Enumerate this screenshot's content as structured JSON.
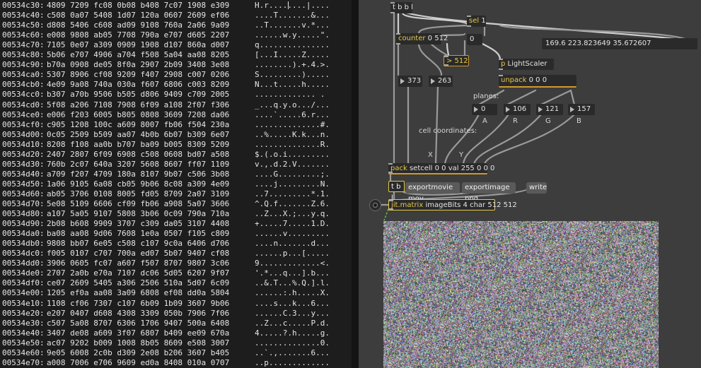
{
  "hexdump": {
    "rows": [
      {
        "addr": "00534c30:",
        "bytes": "4809 7209 fc08 0b08 b408 7c07 1908 e309",
        "ascii": "H.r........|...."
      },
      {
        "addr": "00534c40:",
        "bytes": "c508 0a07 5408 1d07 120a 0607 2609 ef06",
        "ascii": "....T.......&..."
      },
      {
        "addr": "00534c50:",
        "bytes": "d808 5406 c608 ad09 9108 760a 2a06 9a09",
        "ascii": "..T.......v.*..."
      },
      {
        "addr": "00534c60:",
        "bytes": "e008 9808 ab05 7708 790a e707 d605 2207",
        "ascii": "......w.y.....\"."
      },
      {
        "addr": "00534c70:",
        "bytes": "7105 0e07 a309 0909 1908 d107 860a d007",
        "ascii": "q..............."
      },
      {
        "addr": "00534c80:",
        "bytes": "5b06 e707 4906 a704 f508 5a04 aa08 8205",
        "ascii": "[...I.....Z....."
      },
      {
        "addr": "00534c90:",
        "bytes": "b70a 0908 de05 8f0a 2907 2b09 3408 3e08",
        "ascii": "........).+.4.>."
      },
      {
        "addr": "00534ca0:",
        "bytes": "5307 8906 cf08 9209 f407 2908 c007 0206",
        "ascii": "S.........)....."
      },
      {
        "addr": "00534cb0:",
        "bytes": "4e09 9a08 740a 030a f607 6806 c003 8209",
        "ascii": "N...t.....h....."
      },
      {
        "addr": "00534cc0:",
        "bytes": "b307 a70b 9506 b505 d806 9409 c709 2005",
        "ascii": "............. ."
      },
      {
        "addr": "00534cd0:",
        "bytes": "5f08 a206 7108 7908 6f09 a108 2f07 f306",
        "ascii": "_...q.y.o.../..."
      },
      {
        "addr": "00534ce0:",
        "bytes": "e006 f203 6005 b805 0808 3609 7208 da06",
        "ascii": "....`.....6.r..."
      },
      {
        "addr": "00534cf0:",
        "bytes": "c905 1208 100c a609 8007 fb06 f504 230a",
        "ascii": "..............#."
      },
      {
        "addr": "00534d00:",
        "bytes": "0c05 2509 b509 aa07 4b0b 6b07 b309 6e07",
        "ascii": "..%.....K.k...n."
      },
      {
        "addr": "00534d10:",
        "bytes": "8208 f108 aa0b b707 ba09 b005 8309 5209",
        "ascii": "..............R."
      },
      {
        "addr": "00534d20:",
        "bytes": "2407 2807 6f09 6908 c508 0608 bd07 a508",
        "ascii": "$.(.o.i........."
      },
      {
        "addr": "00534d30:",
        "bytes": "760b 2c07 640a 3207 5608 8607 ff07 1109",
        "ascii": "v.,.d.2.V......."
      },
      {
        "addr": "00534d40:",
        "bytes": "a709 f207 4709 180a 8107 9b07 c506 3b08",
        "ascii": "....G.........;."
      },
      {
        "addr": "00534d50:",
        "bytes": "1a06 9105 6a08 cb05 9b06 8c08 a309 4e09",
        "ascii": "....j.........N."
      },
      {
        "addr": "00534d60:",
        "bytes": "ab05 3706 0108 8005 fd05 8709 2a07 3109",
        "ascii": "..7.........*.1."
      },
      {
        "addr": "00534d70:",
        "bytes": "5e08 5109 6606 cf09 fb06 a908 5a07 3606",
        "ascii": "^.Q.f.......Z.6."
      },
      {
        "addr": "00534d80:",
        "bytes": "a107 5a05 9107 5808 3b06 0c09 790a 710a",
        "ascii": "..Z...X.;...y.q."
      },
      {
        "addr": "00534d90:",
        "bytes": "2b08 b608 9909 3707 c309 da05 3107 4408",
        "ascii": "+.....7.....1.D."
      },
      {
        "addr": "00534da0:",
        "bytes": "ba08 aa08 9d06 7608 1e0a 0507 f105 c809",
        "ascii": "......v........."
      },
      {
        "addr": "00534db0:",
        "bytes": "9808 bb07 6e05 c508 c107 9c0a 6406 d706",
        "ascii": "....n.......d..."
      },
      {
        "addr": "00534dc0:",
        "bytes": "f005 0107 c707 700a ed07 5b07 9407 cf08",
        "ascii": "......p...[....."
      },
      {
        "addr": "00534dd0:",
        "bytes": "3906 0605 fc07 a607 f507 8707 9807 3c06",
        "ascii": "9.............<."
      },
      {
        "addr": "00534de0:",
        "bytes": "2707 2a0b e70a 7107 dc06 5d05 6207 9f07",
        "ascii": "'.*...q...].b..."
      },
      {
        "addr": "00534df0:",
        "bytes": "ce07 2609 5405 a306 2506 510a 5d07 6c09",
        "ascii": "..&.T...%.Q.].l."
      },
      {
        "addr": "00534e00:",
        "bytes": "1205 ef0a aa08 3a09 6808 ef08 dd0a 5804",
        "ascii": "......:.h.....X."
      },
      {
        "addr": "00534e10:",
        "bytes": "1108 cf06 7307 c107 6b09 1b09 3607 9b06",
        "ascii": "....s...k...6..."
      },
      {
        "addr": "00534e20:",
        "bytes": "e207 0407 d608 4308 3309 050b 7906 7f06",
        "ascii": "......C.3...y..."
      },
      {
        "addr": "00534e30:",
        "bytes": "c507 5a08 8707 6306 1706 9407 500a 6408",
        "ascii": "..Z...c.....P.d."
      },
      {
        "addr": "00534e40:",
        "bytes": "3407 de08 a609 3f07 6807 b409 ee09 670a",
        "ascii": "4.....?.h.....g."
      },
      {
        "addr": "00534e50:",
        "bytes": "ac07 9202 b009 1008 8b05 8609 e508 3007",
        "ascii": "..............0."
      },
      {
        "addr": "00534e60:",
        "bytes": "9e05 6008 2c0b d309 2e08 b206 3607 b405",
        "ascii": "..`.,.......6..."
      },
      {
        "addr": "00534e70:",
        "bytes": "a008 7006 e706 9609 ed0a 8408 010a 0707",
        "ascii": "..p............."
      }
    ]
  },
  "patcher": {
    "tbbl_top": "t b b l",
    "counter": "counter",
    "counter_args": "0 512",
    "sel": "sel",
    "sel_args": "1",
    "num_zero": "0",
    "gt": "> 512",
    "list_display": "169.6 223.823649 35.672607",
    "p_obj": "p",
    "p_args": "LightScaler",
    "unpack": "unpack",
    "unpack_args": "0 0 0",
    "num_373": "373",
    "num_263": "263",
    "planes_label": "planes:",
    "num_0": "0",
    "num_106": "106",
    "num_121": "121",
    "num_157": "157",
    "label_a": "A",
    "label_r": "R",
    "label_g": "G",
    "label_b": "B",
    "cell_label": "cell coordinates:",
    "label_x": "X",
    "label_y": "Y",
    "pack": "pack",
    "pack_args": "setcell 0 0 val 255 0 0 0",
    "tbl": "t b l",
    "msg_movie": "exportmovie mov",
    "msg_image": "exportimage png",
    "msg_write": "write",
    "jit": "jit.matrix",
    "jit_args": "imageBits 4 char 512 512"
  },
  "colors": {
    "patcher_bg": "#3d3d3d",
    "object_bg": "#2a2a2a",
    "accent": "#e6c94a",
    "hexdump_bg": "#1d1d1d"
  }
}
